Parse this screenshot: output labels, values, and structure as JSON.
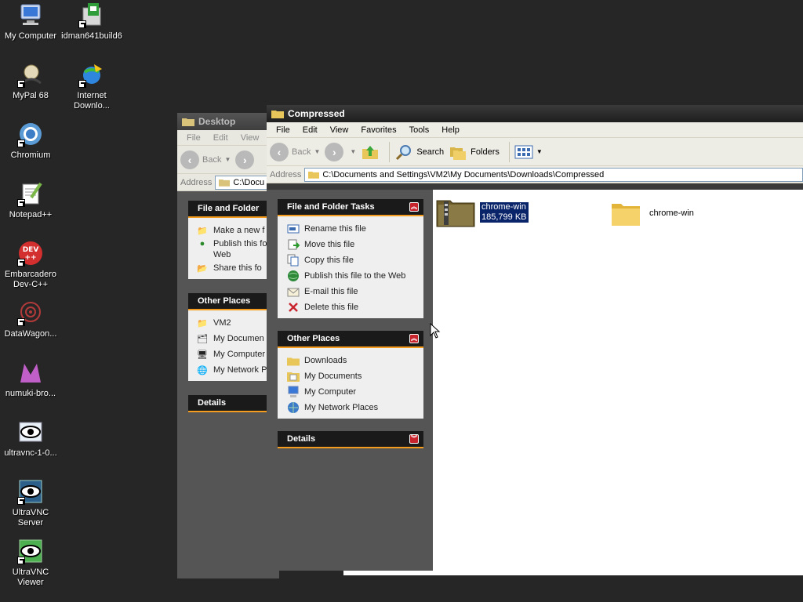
{
  "desktop": {
    "icons": [
      {
        "label": "My Computer"
      },
      {
        "label": "idman641build6"
      },
      {
        "label": "MyPal 68"
      },
      {
        "label": "Internet Downlo..."
      },
      {
        "label": "Chromium"
      },
      {
        "label": "Notepad++"
      },
      {
        "label": "Embarcadero Dev-C++"
      },
      {
        "label": "DataWagon..."
      },
      {
        "label": "numuki-bro..."
      },
      {
        "label": "ultravnc-1-0..."
      },
      {
        "label": "UltraVNC Server"
      },
      {
        "label": "UltraVNC Viewer"
      }
    ]
  },
  "back_window": {
    "title": "Desktop",
    "menu": [
      "File",
      "Edit",
      "View"
    ],
    "back_label": "Back",
    "address_label": "Address",
    "address_value": "C:\\Docu",
    "file_tasks": {
      "title": "File and Folder",
      "items": [
        "Make a new f",
        "Publish this fo",
        "Web",
        "Share this fo"
      ]
    },
    "other_places": {
      "title": "Other Places",
      "items": [
        "VM2",
        "My Documen",
        "My Computer",
        "My Network P"
      ]
    },
    "details": {
      "title": "Details"
    }
  },
  "front_window": {
    "title": "Compressed",
    "menu": [
      "File",
      "Edit",
      "View",
      "Favorites",
      "Tools",
      "Help"
    ],
    "toolbar": {
      "back": "Back",
      "search": "Search",
      "folders": "Folders"
    },
    "address_label": "Address",
    "address_value": "C:\\Documents and Settings\\VM2\\My Documents\\Downloads\\Compressed",
    "file_tasks": {
      "title": "File and Folder Tasks",
      "items": [
        "Rename this file",
        "Move this file",
        "Copy this file",
        "Publish this file to the Web",
        "E-mail this file",
        "Delete this file"
      ]
    },
    "other_places": {
      "title": "Other Places",
      "items": [
        "Downloads",
        "My Documents",
        "My Computer",
        "My Network Places"
      ]
    },
    "details": {
      "title": "Details"
    },
    "files": [
      {
        "name": "chrome-win",
        "size": "185,799 KB",
        "type": "zip",
        "selected": true
      },
      {
        "name": "chrome-win",
        "size": "",
        "type": "folder",
        "selected": false
      }
    ]
  },
  "colors": {
    "desktop": "#262626",
    "accent": "#f39c1d",
    "panel_head": "#1a1a1a",
    "selection": "#0a246a"
  }
}
